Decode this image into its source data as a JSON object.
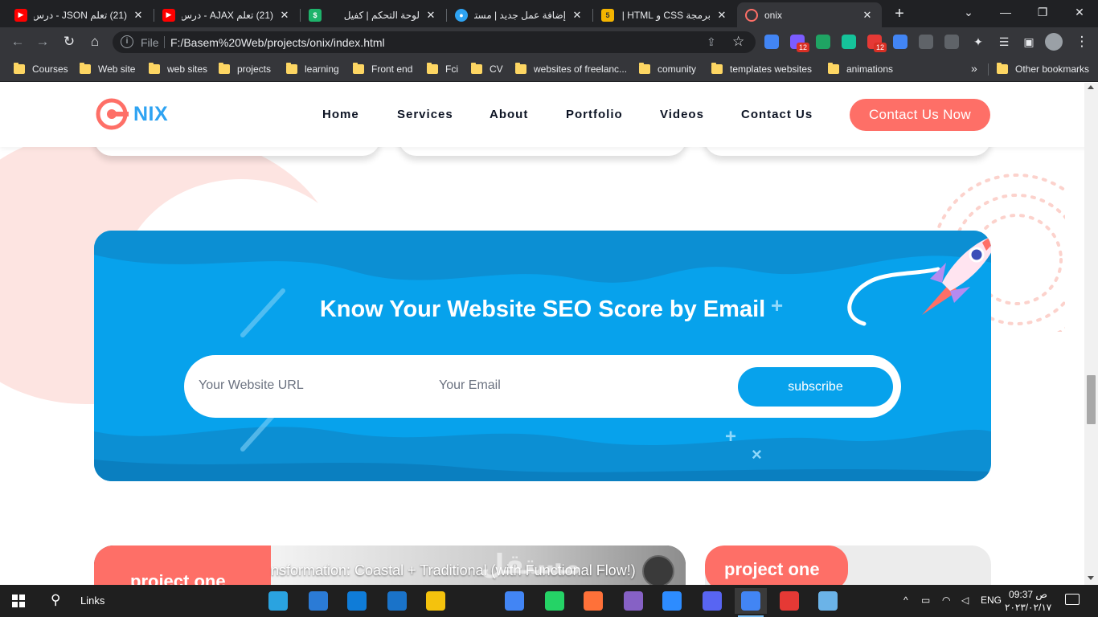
{
  "browser": {
    "tabs": [
      {
        "title": "(21) تعلم JSON - درس",
        "favicon": "youtube-icon",
        "color": "#ff0000"
      },
      {
        "title": "(21) تعلم AJAX - درس",
        "favicon": "youtube-icon",
        "color": "#ff0000"
      },
      {
        "title": "لوحة التحكم | كفيل",
        "favicon": "kafeel-icon",
        "color": "#1eb36b"
      },
      {
        "title": "إضافة عمل جديد | مستقل",
        "favicon": "mostaql-icon",
        "color": "#2ea3f2"
      },
      {
        "title": "برمجة CSS و HTML | خمسات",
        "favicon": "khamsat-icon",
        "color": "#f4b400"
      },
      {
        "title": "onix",
        "favicon": "onix-icon",
        "color": "#fe6f67"
      }
    ],
    "omnibox": {
      "scheme_label": "File",
      "url": "F:/Basem%20Web/projects/onix/index.html"
    },
    "extensions": [
      {
        "name": "translate-ext-icon",
        "color": "#4285f4",
        "badge": ""
      },
      {
        "name": "purple-ext-icon",
        "color": "#7b5cff",
        "badge": "12"
      },
      {
        "name": "google-drive-ext-icon",
        "color": "#1fa463",
        "badge": ""
      },
      {
        "name": "grammarly-ext-icon",
        "color": "#15c39a",
        "badge": ""
      },
      {
        "name": "red-ext-icon",
        "color": "#e53935",
        "badge": "12"
      },
      {
        "name": "chrome-ext-icon",
        "color": "#4285f4",
        "badge": ""
      },
      {
        "name": "q-ext-icon",
        "color": "#5f6368",
        "badge": ""
      },
      {
        "name": "a-ext-icon",
        "color": "#5f6368",
        "badge": ""
      }
    ],
    "bookmarks": [
      "Courses",
      "Web site",
      "web sites",
      "projects",
      "learning",
      "Front end",
      "Fci",
      "CV",
      "websites of freelanc...",
      "comunity",
      "templates websites",
      "animations"
    ],
    "other_bookmarks": "Other bookmarks"
  },
  "page": {
    "logo_text": "NIX",
    "nav": [
      "Home",
      "Services",
      "About",
      "Portfolio",
      "Videos",
      "Contact Us"
    ],
    "cta": "Contact Us Now",
    "seo": {
      "title": "Know Your Website SEO Score by Email",
      "url_placeholder": "Your Website URL",
      "email_placeholder": "Your Email",
      "button": "subscribe"
    },
    "projects": [
      {
        "label": "project one",
        "video_title": "nsformation: Coastal + Traditional (with Functional Flow!)"
      },
      {
        "label": "project one"
      }
    ],
    "watermark": "مستقل"
  },
  "taskbar": {
    "links_label": "Links",
    "apps": [
      "telegram-icon",
      "vscode-icon",
      "edge-icon",
      "mail-icon",
      "file-explorer-icon",
      "chrome-icon",
      "whatsapp-icon",
      "firefox-icon",
      "visual-studio-icon",
      "zoom-icon",
      "discord-icon",
      "chrome-active-icon",
      "yb-icon",
      "notes-icon"
    ],
    "language": "ENG",
    "time": "09:37 ص",
    "date": "٢٠٢٣/٠٢/١٧"
  },
  "colors": {
    "brand_blue": "#2ea3f2",
    "accent_coral": "#fe6f67",
    "seo_blue": "#07a2ec"
  }
}
